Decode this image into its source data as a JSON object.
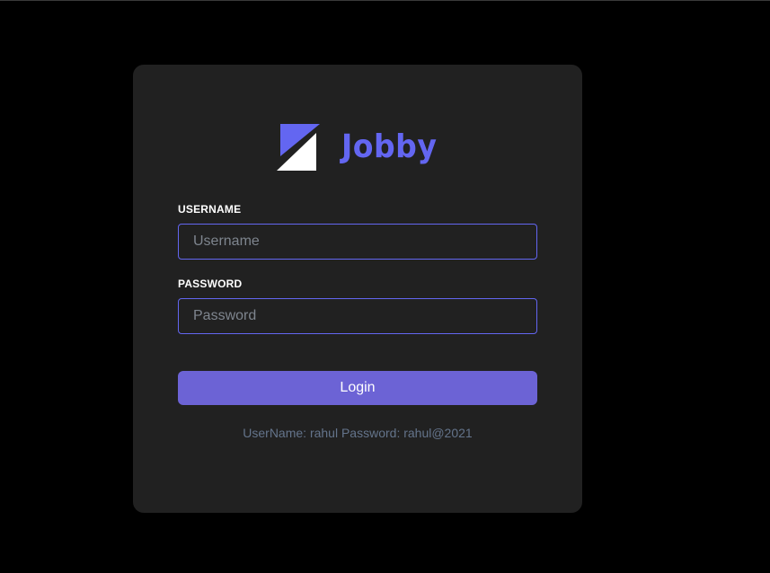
{
  "brand": {
    "name": "Jobby",
    "logo_icon": "jobby-logo-icon",
    "accent_color": "#6366f1"
  },
  "form": {
    "username_label": "USERNAME",
    "username_placeholder": "Username",
    "username_value": "",
    "password_label": "PASSWORD",
    "password_placeholder": "Password",
    "password_value": "",
    "login_label": "Login",
    "button_color": "#6c63d5"
  },
  "hint": {
    "text": "UserName: rahul Password: rahul@2021"
  }
}
